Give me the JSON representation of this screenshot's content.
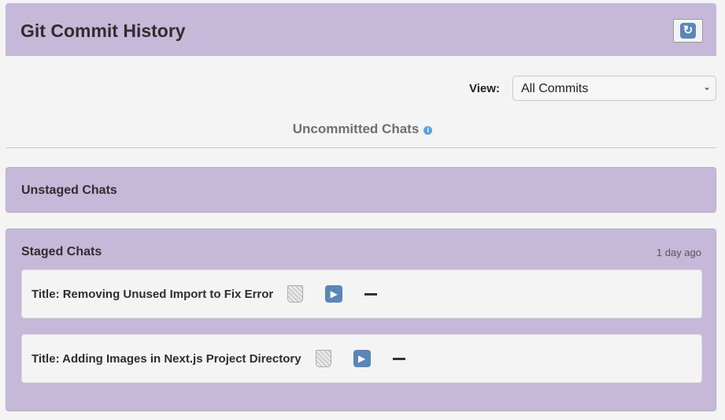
{
  "header": {
    "title": "Git Commit History",
    "refresh_icon": "refresh-icon"
  },
  "view": {
    "label": "View:",
    "selected": "All Commits"
  },
  "uncommitted": {
    "title": "Uncommitted Chats",
    "info_icon": "i"
  },
  "unstaged": {
    "title": "Unstaged Chats"
  },
  "staged": {
    "title": "Staged Chats",
    "time": "1 day ago",
    "items": [
      {
        "title": "Title: Removing Unused Import to Fix Error"
      },
      {
        "title": "Title: Adding Images in Next.js Project Directory"
      }
    ]
  },
  "colors": {
    "panel": "#c6b8d9",
    "background": "#f4f4f4",
    "accent": "#5aa3dc"
  }
}
